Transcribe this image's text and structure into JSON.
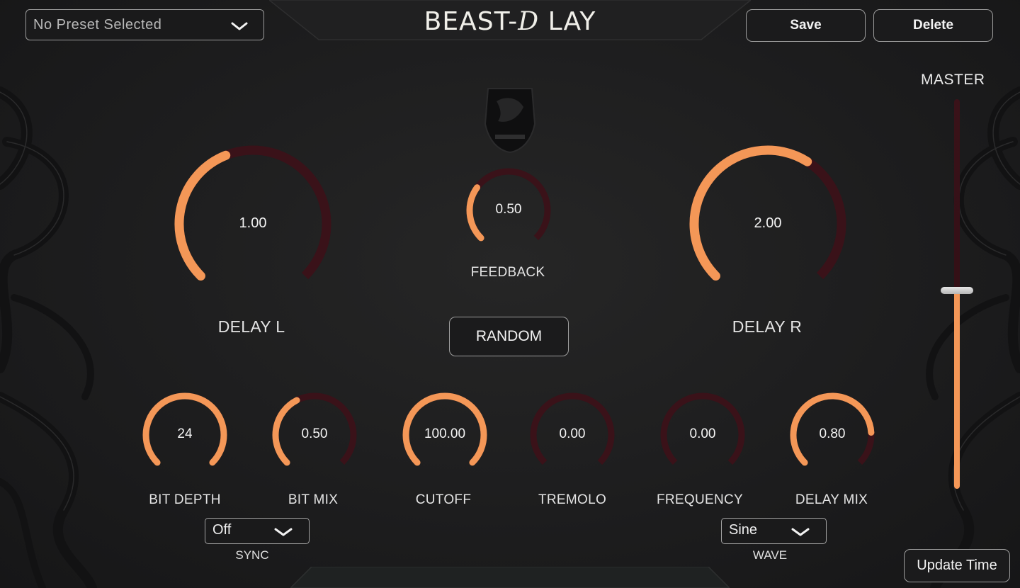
{
  "app": {
    "title_prefix": "BEAST-",
    "title_d": "D",
    "title_suffix": "LAY"
  },
  "preset": {
    "selected": "No Preset Selected"
  },
  "buttons": {
    "save": "Save",
    "delete": "Delete",
    "random": "RANDOM",
    "update_time": "Update Time"
  },
  "colors": {
    "accent": "#f49757",
    "track": "#3a1219",
    "background": "#1c1c1d"
  },
  "knobs": {
    "delay_l": {
      "label": "DELAY L",
      "value": "1.00",
      "fill": 0.42
    },
    "feedback": {
      "label": "FEEDBACK",
      "value": "0.50",
      "fill": 0.3
    },
    "delay_r": {
      "label": "DELAY R",
      "value": "2.00",
      "fill": 0.62
    },
    "bit_depth": {
      "label": "BIT DEPTH",
      "value": "24",
      "fill": 1.0
    },
    "bit_mix": {
      "label": "BIT MIX",
      "value": "0.50",
      "fill": 0.4
    },
    "cutoff": {
      "label": "CUTOFF",
      "value": "100.00",
      "fill": 1.0
    },
    "tremolo": {
      "label": "TREMOLO",
      "value": "0.00",
      "fill": 0.0
    },
    "frequency": {
      "label": "FREQUENCY",
      "value": "0.00",
      "fill": 0.0
    },
    "delay_mix": {
      "label": "DELAY MIX",
      "value": "0.80",
      "fill": 0.82
    }
  },
  "sync": {
    "selected": "Off",
    "label": "SYNC"
  },
  "wave": {
    "selected": "Sine",
    "label": "WAVE"
  },
  "master": {
    "label": "MASTER",
    "level": 0.51
  }
}
